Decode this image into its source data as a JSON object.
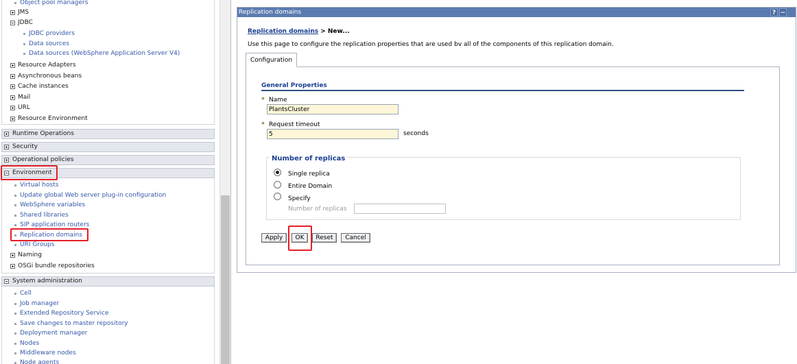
{
  "nav": {
    "resources_items": [
      {
        "label": "Object pool managers",
        "type": "link"
      },
      {
        "label": "JMS",
        "type": "group",
        "expanded": false
      },
      {
        "label": "JDBC",
        "type": "group",
        "expanded": true
      },
      {
        "label": "JDBC providers",
        "type": "sublink"
      },
      {
        "label": "Data sources",
        "type": "sublink"
      },
      {
        "label": "Data sources (WebSphere Application Server V4)",
        "type": "sublink"
      },
      {
        "label": "Resource Adapters",
        "type": "group",
        "expanded": false
      },
      {
        "label": "Asynchronous beans",
        "type": "group",
        "expanded": false
      },
      {
        "label": "Cache instances",
        "type": "group",
        "expanded": false
      },
      {
        "label": "Mail",
        "type": "group",
        "expanded": false
      },
      {
        "label": "URL",
        "type": "group",
        "expanded": false
      },
      {
        "label": "Resource Environment",
        "type": "group",
        "expanded": false
      }
    ],
    "sections": [
      {
        "label": "Runtime Operations",
        "expanded": false
      },
      {
        "label": "Security",
        "expanded": false
      },
      {
        "label": "Operational policies",
        "expanded": false
      },
      {
        "label": "Environment",
        "expanded": true
      },
      {
        "label": "System administration",
        "expanded": true
      }
    ],
    "environment_items": [
      {
        "label": "Virtual hosts",
        "type": "link"
      },
      {
        "label": "Update global Web server plug-in configuration",
        "type": "link"
      },
      {
        "label": "WebSphere variables",
        "type": "link"
      },
      {
        "label": "Shared libraries",
        "type": "link"
      },
      {
        "label": "SIP application routers",
        "type": "link"
      },
      {
        "label": "Replication domains",
        "type": "link"
      },
      {
        "label": "URI Groups",
        "type": "link"
      },
      {
        "label": "Naming",
        "type": "group"
      },
      {
        "label": "OSGi bundle repositories",
        "type": "group"
      }
    ],
    "sysadmin_items": [
      {
        "label": "Cell",
        "type": "link"
      },
      {
        "label": "Job manager",
        "type": "link"
      },
      {
        "label": "Extended Repository Service",
        "type": "link"
      },
      {
        "label": "Save changes to master repository",
        "type": "link"
      },
      {
        "label": "Deployment manager",
        "type": "link"
      },
      {
        "label": "Nodes",
        "type": "link"
      },
      {
        "label": "Middleware nodes",
        "type": "link"
      },
      {
        "label": "Node agents",
        "type": "link"
      }
    ]
  },
  "panel": {
    "title": "Replication domains",
    "help_label": "?",
    "minimize_label": "−",
    "breadcrumb_link": "Replication domains",
    "breadcrumb_current": " > New...",
    "description": "Use this page to configure the replication properties that are used bv all of the components of this replication domain.",
    "tab": "Configuration",
    "general_properties": "General Properties",
    "required_marker": "*",
    "name_label": "Name",
    "name_value": "PlantsCluster",
    "timeout_label": "Request timeout",
    "timeout_value": "5",
    "timeout_unit": "seconds",
    "replicas_legend": "Number of replicas",
    "replica_options": [
      {
        "label": "Single replica",
        "selected": true
      },
      {
        "label": "Entire Domain",
        "selected": false
      },
      {
        "label": "Specify",
        "selected": false
      }
    ],
    "replicas_field_label": "Number of replicas",
    "replicas_field_value": "",
    "buttons": {
      "apply": "Apply",
      "ok": "OK",
      "reset": "Reset",
      "cancel": "Cancel"
    }
  },
  "colors": {
    "titlebar": "#5b7bb0",
    "link": "#3458a8",
    "highlight": "#e41e26",
    "input_bg": "#fdf6d8"
  }
}
